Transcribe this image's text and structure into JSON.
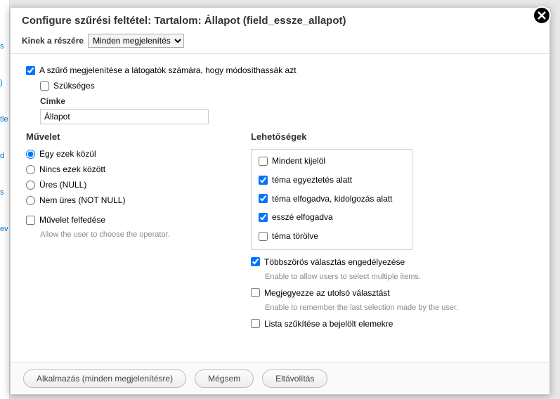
{
  "modal": {
    "title": "Configure szűrési feltétel: Tartalom: Állapot (field_essze_allapot)",
    "expose_label": "Kinek a részére",
    "expose_select": "Minden megjelenítés"
  },
  "body": {
    "expose_filter_label": "A szűrő megjelenítése a látogatók számára, hogy módosíthassák azt",
    "required_label": "Szükséges",
    "cimke_heading": "Címke",
    "cimke_value": "Állapot"
  },
  "operator": {
    "heading": "Művelet",
    "options": [
      {
        "label": "Egy ezek közül",
        "checked": true
      },
      {
        "label": "Nincs ezek között",
        "checked": false
      },
      {
        "label": "Üres (NULL)",
        "checked": false
      },
      {
        "label": "Nem üres (NOT NULL)",
        "checked": false
      }
    ],
    "expose_op_label": "Művelet felfedése",
    "expose_op_help": "Allow the user to choose the operator."
  },
  "options": {
    "heading": "Lehetőségek",
    "items": [
      {
        "label": "Mindent kijelöl",
        "checked": false
      },
      {
        "label": "téma egyeztetés alatt",
        "checked": true
      },
      {
        "label": "téma elfogadva, kidolgozás alatt",
        "checked": true
      },
      {
        "label": "esszé elfogadva",
        "checked": true
      },
      {
        "label": "téma törölve",
        "checked": false
      }
    ],
    "multi_label": "Többszörös választás engedélyezése",
    "multi_help": "Enable to allow users to select multiple items.",
    "remember_label": "Megjegyezze az utolsó választást",
    "remember_help": "Enable to remember the last selection made by the user.",
    "limit_label": "Lista szűkítése a bejelölt elemekre"
  },
  "footer": {
    "apply": "Alkalmazás (minden megjelenítésre)",
    "cancel": "Mégsem",
    "remove": "Eltávolítás"
  }
}
